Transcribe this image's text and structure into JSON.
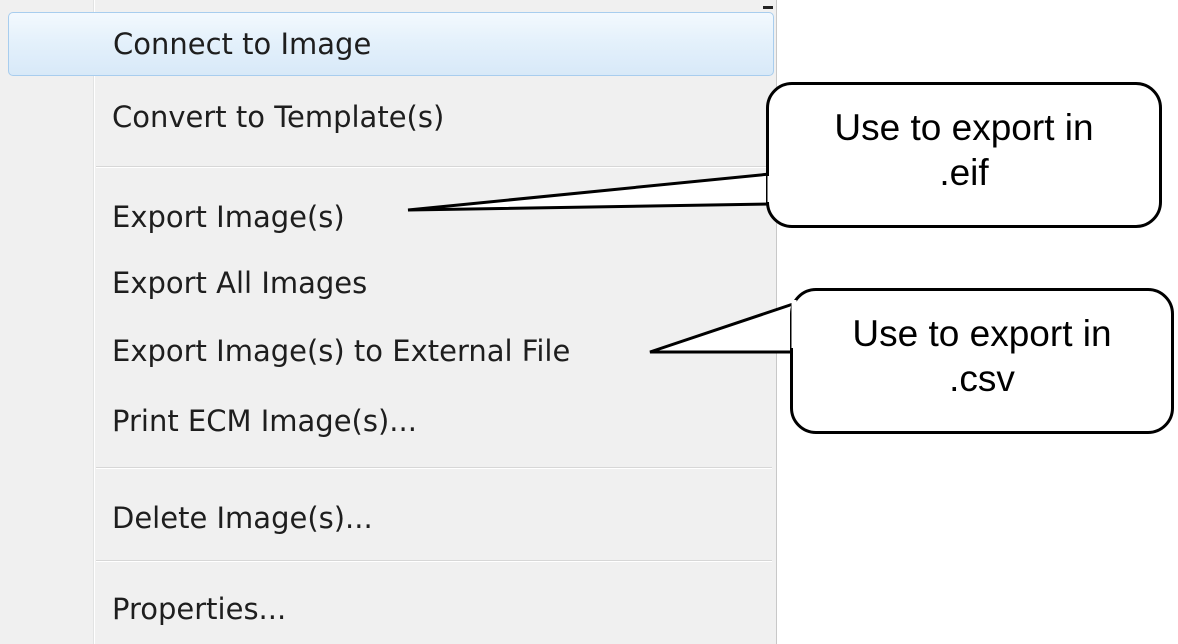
{
  "menu": {
    "items": [
      {
        "label": "Connect to Image"
      },
      {
        "label": "Convert to Template(s)"
      },
      {
        "label": "Export Image(s)"
      },
      {
        "label": "Export All Images"
      },
      {
        "label": "Export Image(s) to External File"
      },
      {
        "label": "Print ECM Image(s)..."
      },
      {
        "label": "Delete Image(s)..."
      },
      {
        "label": "Properties..."
      }
    ],
    "highlighted_index": 0
  },
  "callouts": {
    "eif": {
      "line1": "Use to export in",
      "line2": ".eif"
    },
    "csv": {
      "line1": "Use to export in",
      "line2": ".csv"
    }
  },
  "colors": {
    "menu_background": "#f0f0f0",
    "highlight_border": "#a8cdee",
    "callout_border": "#000000"
  }
}
